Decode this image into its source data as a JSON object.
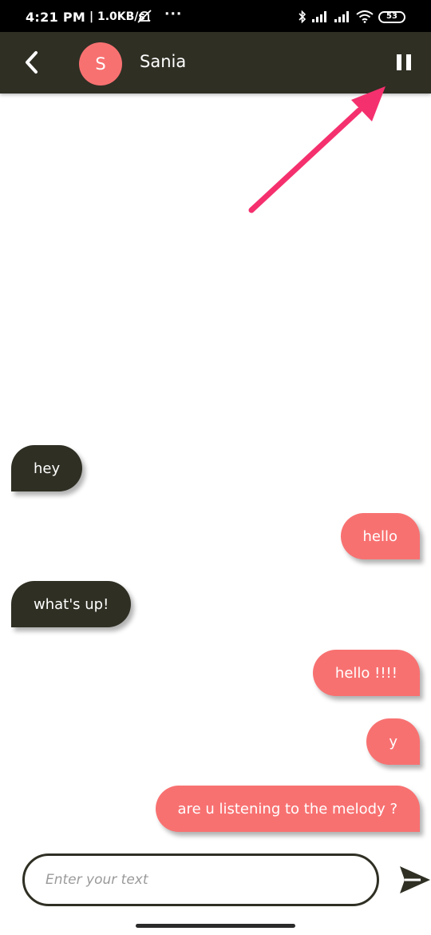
{
  "status_bar": {
    "time": "4:21 PM",
    "network_speed": "| 1.0KB/s",
    "more_dots": "···",
    "battery_level": "53"
  },
  "header": {
    "avatar_initial": "S",
    "contact_name": "Sania",
    "avatar_color": "#f87171",
    "bar_color": "#2f2f24"
  },
  "messages": [
    {
      "text": "hey",
      "direction": "received"
    },
    {
      "text": "hello",
      "direction": "sent"
    },
    {
      "text": "what's up!",
      "direction": "received"
    },
    {
      "text": "hello !!!!",
      "direction": "sent"
    },
    {
      "text": "y",
      "direction": "sent"
    },
    {
      "text": "are u listening to the melody ?",
      "direction": "sent"
    }
  ],
  "composer": {
    "placeholder": "Enter your text",
    "value": ""
  },
  "icons": {
    "back": "chevron-left-icon",
    "pause": "pause-icon",
    "send": "send-icon",
    "annotation": "arrow-annotation"
  },
  "colors": {
    "sent_bubble": "#f87171",
    "received_bubble": "#2f2f24",
    "annotation_arrow": "#f5306e"
  }
}
